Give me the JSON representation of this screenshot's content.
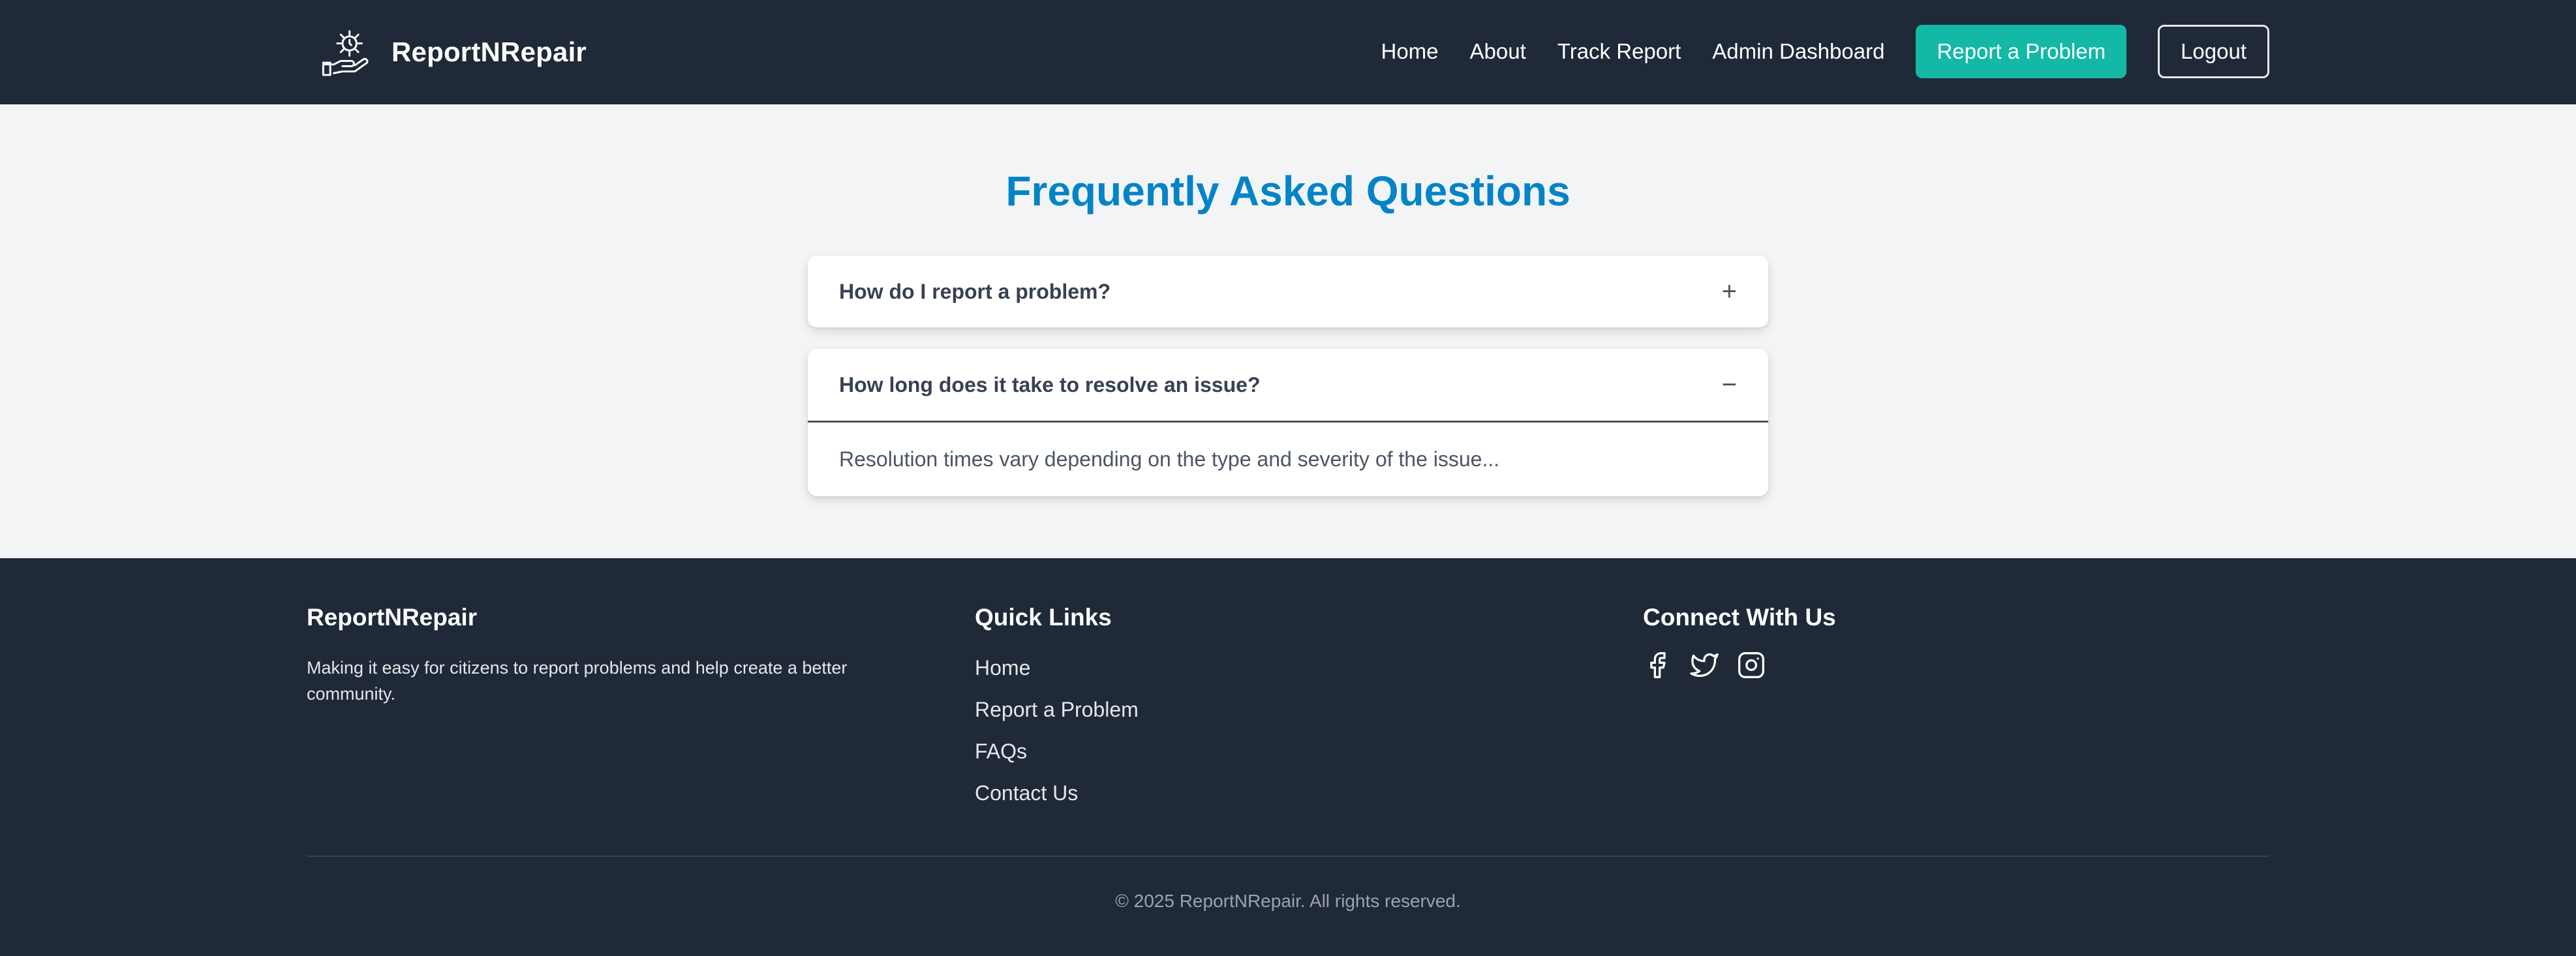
{
  "navbar": {
    "brand_name": "ReportNRepair",
    "logo_icon": "gear-hand-logo-icon",
    "links": [
      "Home",
      "About",
      "Track Report",
      "Admin Dashboard"
    ],
    "report_button": "Report a Problem",
    "logout_button": "Logout",
    "colors": {
      "background": "#1f2937",
      "accent": "#14b8a6"
    }
  },
  "faq": {
    "title": "Frequently Asked Questions",
    "title_color": "#0284c7",
    "items": [
      {
        "question": "How do I report a problem?",
        "toggle": "+",
        "expanded": false
      },
      {
        "question": "How long does it take to resolve an issue?",
        "toggle": "−",
        "expanded": true,
        "answer": "Resolution times vary depending on the type and severity of the issue..."
      }
    ]
  },
  "footer": {
    "about": {
      "heading": "ReportNRepair",
      "description": "Making it easy for citizens to report problems and help create a better community."
    },
    "quick_links": {
      "heading": "Quick Links",
      "links": [
        "Home",
        "Report a Problem",
        "FAQs",
        "Contact Us"
      ]
    },
    "connect": {
      "heading": "Connect With Us",
      "icons": [
        "facebook-icon",
        "twitter-icon",
        "instagram-icon"
      ]
    },
    "copyright": "© 2025 ReportNRepair. All rights reserved."
  }
}
